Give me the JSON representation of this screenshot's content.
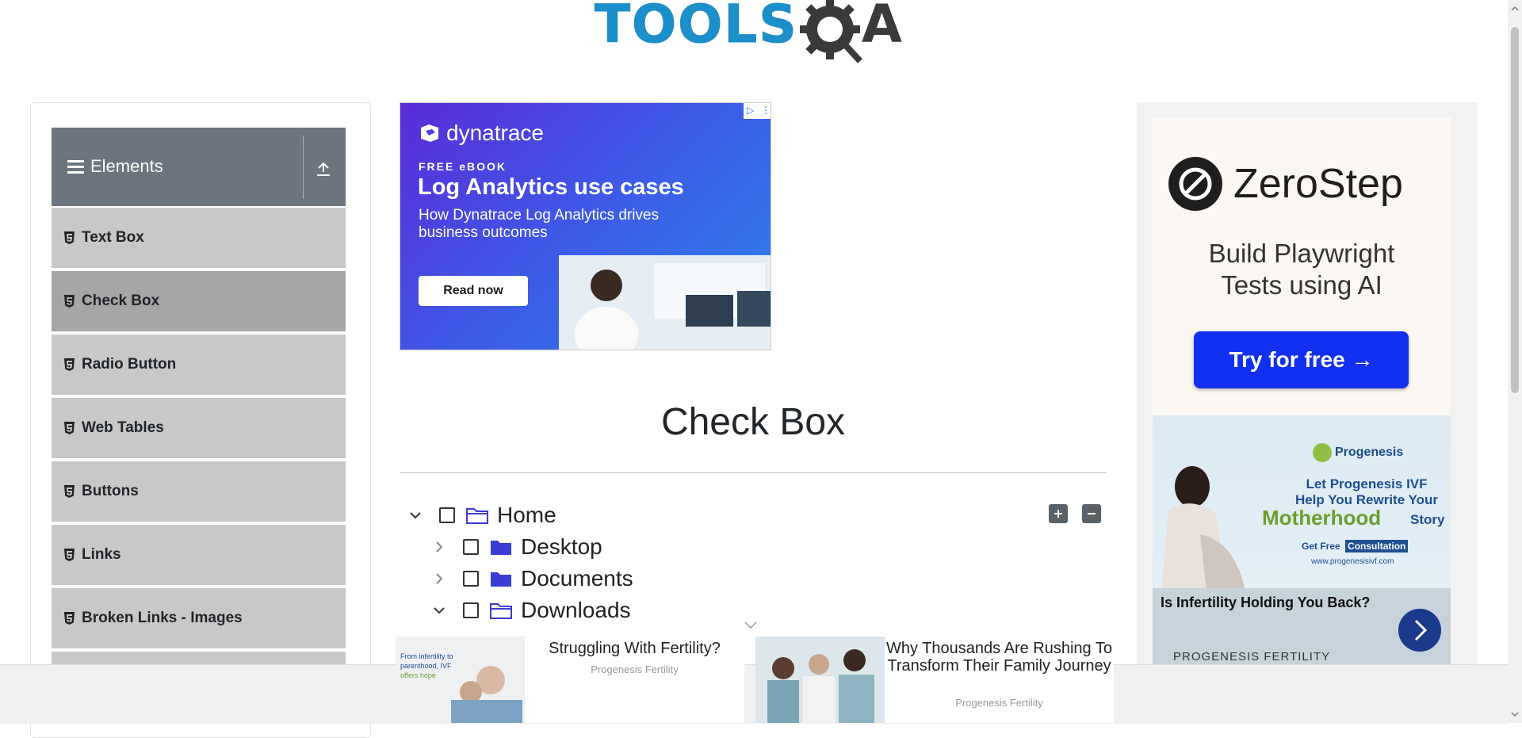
{
  "header": {
    "logo_text_1": "TOOLS",
    "logo_text_2": "A"
  },
  "sidebar": {
    "group_title": "Elements",
    "items": [
      {
        "label": "Text Box",
        "active": false
      },
      {
        "label": "Check Box",
        "active": true
      },
      {
        "label": "Radio Button",
        "active": false
      },
      {
        "label": "Web Tables",
        "active": false
      },
      {
        "label": "Buttons",
        "active": false
      },
      {
        "label": "Links",
        "active": false
      },
      {
        "label": "Broken Links - Images",
        "active": false
      }
    ]
  },
  "ad_top": {
    "brand": "dynatrace",
    "eyebrow": "FREE eBOOK",
    "headline": "Log Analytics use cases",
    "subtext": "How Dynatrace Log Analytics drives business outcomes",
    "cta": "Read now"
  },
  "main": {
    "title": "Check Box",
    "tree": [
      {
        "label": "Home",
        "expanded": true,
        "level": 0
      },
      {
        "label": "Desktop",
        "expanded": false,
        "level": 1
      },
      {
        "label": "Documents",
        "expanded": false,
        "level": 1
      },
      {
        "label": "Downloads",
        "expanded": true,
        "level": 1
      }
    ]
  },
  "ad_right": {
    "brand": "ZeroStep",
    "tagline_1": "Build Playwright",
    "tagline_2": "Tests using AI",
    "cta": "Try for free →"
  },
  "ad_progenesis": {
    "brand": "Progenesis",
    "line_1": "Let Progenesis IVF",
    "line_2": "Help You Rewrite Your",
    "highlight": "Motherhood",
    "story": "Story",
    "get_free": "Get Free",
    "consultation": "Consultation",
    "url": "www.progenesisivf.com",
    "question": "Is Infertility Holding You Back?",
    "company": "PROGENESIS FERTILITY"
  },
  "bottom_ads": [
    {
      "title": "Struggling With Fertility?",
      "source": "Progenesis Fertility"
    },
    {
      "title": "Why Thousands Are Rushing To Transform Their Family Journey",
      "source": "Progenesis Fertility"
    }
  ],
  "colors": {
    "primary": "#1c8ec9",
    "sidebar_header": "#6c757d",
    "menu_item": "#c8c8c8",
    "menu_active": "#a6a6a6",
    "folder": "#3b3bd6"
  }
}
